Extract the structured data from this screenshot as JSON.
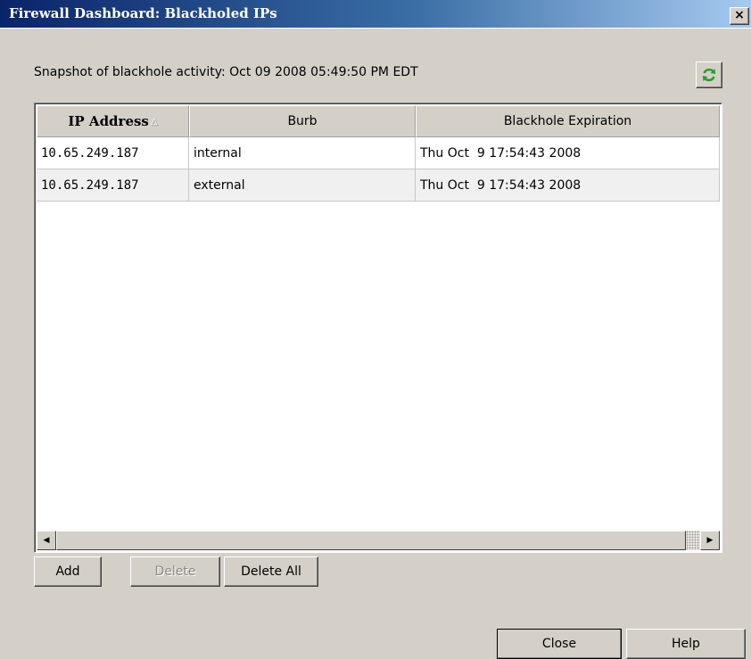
{
  "window": {
    "title": "Firewall Dashboard: Blackholed IPs",
    "close_glyph": "×",
    "close_icon": "close-icon"
  },
  "snapshot": {
    "text": "Snapshot of blackhole activity: Oct 09 2008 05:49:50 PM EDT"
  },
  "refresh": {
    "icon": "refresh-icon",
    "color": "#2e9c2e"
  },
  "table": {
    "columns": [
      {
        "label": "IP Address",
        "sort": "ascending"
      },
      {
        "label": "Burb"
      },
      {
        "label": "Blackhole Expiration"
      }
    ],
    "sort_arrow": "△",
    "rows": [
      {
        "ip": "10.65.249.187",
        "burb": "internal",
        "expiration": "Thu Oct  9 17:54:43 2008"
      },
      {
        "ip": "10.65.249.187",
        "burb": "external",
        "expiration": "Thu Oct  9 17:54:43 2008"
      }
    ]
  },
  "scrollbar": {
    "left_arrow": "◀",
    "right_arrow": "▶"
  },
  "buttons": {
    "add": "Add",
    "delete": "Delete",
    "delete_all": "Delete All",
    "close": "Close",
    "help": "Help"
  }
}
